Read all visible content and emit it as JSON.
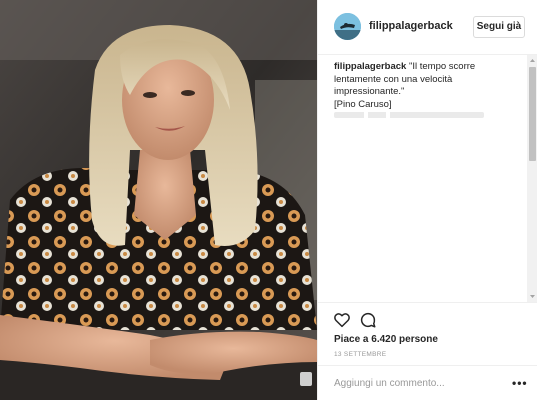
{
  "post": {
    "username": "filippalagerback",
    "follow_label": "Segui già",
    "caption": {
      "username": "filippalagerback",
      "line1": " \"Il tempo scorre",
      "line2": "lentamente con una velocità",
      "line3": "impressionante.\"",
      "line4": "[Pino Caruso]"
    },
    "likes": "Piace a 6.420 persone",
    "date": "13 SETTEMBRE",
    "comment_placeholder": "Aggiungi un commento...",
    "more_label": "•••"
  },
  "icons": {
    "heart": "heart-icon",
    "comment": "comment-icon",
    "avatar": "avatar-image"
  },
  "colors": {
    "text": "#262626",
    "muted": "#999999",
    "border": "#efefef"
  }
}
